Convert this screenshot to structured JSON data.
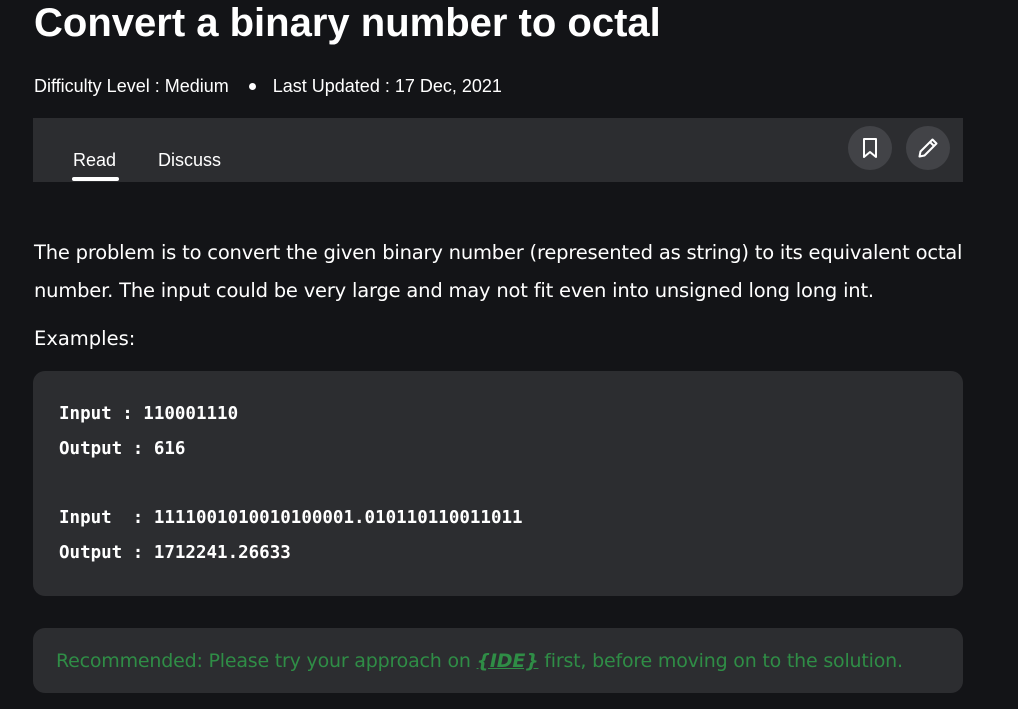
{
  "article": {
    "title": "Convert a binary number to octal",
    "difficulty": "Difficulty Level : Medium",
    "last_updated": "Last Updated : 17 Dec, 2021"
  },
  "tabs": {
    "read": "Read",
    "discuss": "Discuss",
    "active": "Read"
  },
  "actions": {
    "bookmark_icon": "bookmark-icon",
    "edit_icon": "pencil-icon"
  },
  "content": {
    "intro": "The problem is to convert the given binary number (represented as string) to its equivalent octal number. The input could be very large and may not fit even into unsigned long long int.",
    "examples_label": "Examples:",
    "code_lines": [
      "Input : 110001110",
      "Output : 616",
      "Input  : 1111001010010100001.010110110011011",
      "Output : 1712241.26633"
    ]
  },
  "recommended": {
    "before": "Recommended: Please try your approach on ",
    "link": "{IDE}",
    "after": " first, before moving on to the solution."
  },
  "colors": {
    "background": "#131417",
    "panel": "#2c2d30",
    "icon_button": "#424347",
    "accent_green": "#2f8d46",
    "text": "#ffffff"
  }
}
